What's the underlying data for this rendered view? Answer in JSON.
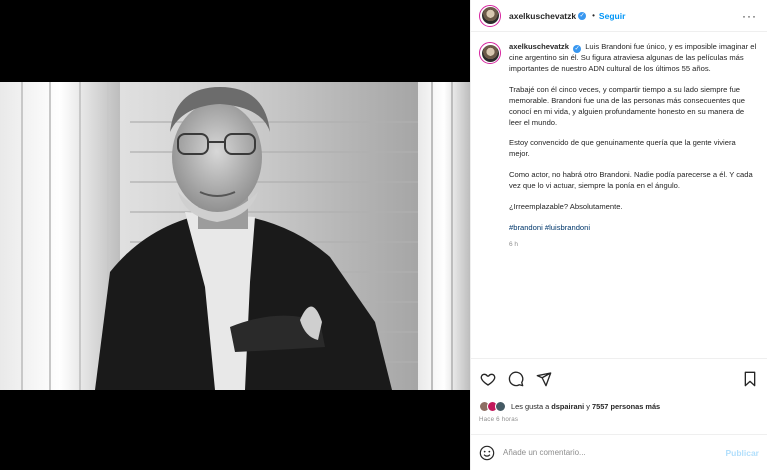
{
  "post": {
    "username": "axelkuschevatzk",
    "follow_label": "Seguir",
    "separator": "•",
    "more_label": "···"
  },
  "caption": {
    "username": "axelkuschevatzk",
    "p1": "Luis Brandoni fue único, y es imposible imaginar el cine argentino sin él. Su figura atraviesa algunas de las películas más importantes de nuestro ADN cultural de los últimos 55 años.",
    "p2": "Trabajé con él cinco veces, y compartir tiempo a su lado siempre fue memorable. Brandoni fue una de las personas más consecuentes que conocí en mi vida, y alguien profundamente honesto en su manera de leer el mundo.",
    "p3": "Estoy convencido de que genuinamente quería que la gente viviera mejor.",
    "p4": "Como actor, no habrá otro Brandoni. Nadie podía parecerse a él. Y cada vez que lo vi actuar, siempre la ponía en el ángulo.",
    "p5": "¿Irreemplazable? Absolutamente.",
    "hashtags": "#brandoni #luisbrandoni",
    "time": "6 h"
  },
  "likes": {
    "prefix": "Les gusta a",
    "user": "dspairani",
    "conj": "y",
    "count": "7557 personas más"
  },
  "posted_ago": "Hace 6 horas",
  "comment": {
    "placeholder": "Añade un comentario...",
    "publish_label": "Publicar"
  },
  "icons": [
    "heart-icon",
    "comment-icon",
    "share-icon",
    "bookmark-icon",
    "emoji-icon",
    "verified-icon",
    "more-options-icon"
  ],
  "colors": {
    "accent": "#0095f6",
    "hashtag": "#00376b",
    "verified": "#3897f0",
    "muted": "#8e8e8e"
  }
}
